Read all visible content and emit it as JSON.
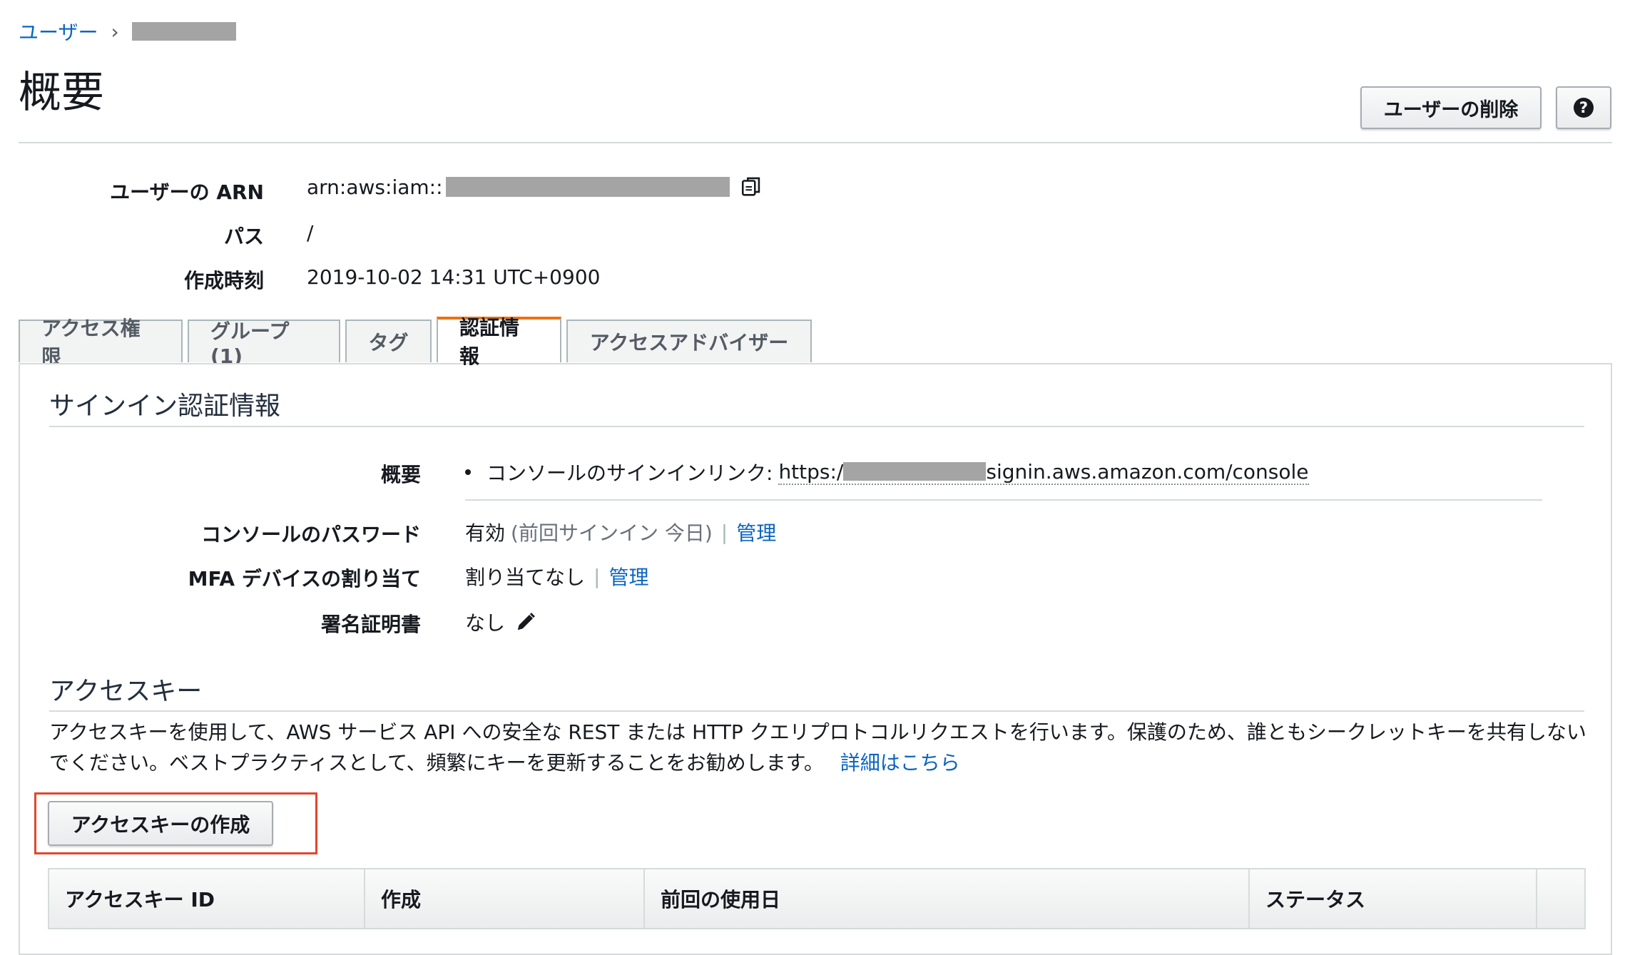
{
  "breadcrumb": {
    "users": "ユーザー",
    "separator": "›"
  },
  "page": {
    "title": "概要"
  },
  "toolbar": {
    "delete_user": "ユーザーの削除",
    "help": "?"
  },
  "summary": {
    "arn_label": "ユーザーの ARN",
    "arn_prefix": "arn:aws:iam::",
    "path_label": "パス",
    "path_value": "/",
    "created_label": "作成時刻",
    "created_value": "2019-10-02 14:31 UTC+0900"
  },
  "tabs": [
    {
      "label": "アクセス権限"
    },
    {
      "label": "グループ (1)"
    },
    {
      "label": "タグ"
    },
    {
      "label": "認証情報"
    },
    {
      "label": "アクセスアドバイザー"
    }
  ],
  "signin": {
    "section_title": "サインイン認証情報",
    "overview_label": "概要",
    "console_link_label": "コンソールのサインインリンク:",
    "console_link_prefix": "https:/",
    "console_link_suffix": "signin.aws.amazon.com/console",
    "password_label": "コンソールのパスワード",
    "password_status": "有効",
    "password_note": "(前回サインイン 今日)",
    "password_manage": "管理",
    "mfa_label": "MFA デバイスの割り当て",
    "mfa_value": "割り当てなし",
    "mfa_manage": "管理",
    "cert_label": "署名証明書",
    "cert_value": "なし"
  },
  "access_keys": {
    "section_title": "アクセスキー",
    "description": "アクセスキーを使用して、AWS サービス API への安全な REST または HTTP クエリプロトコルリクエストを行います。保護のため、誰ともシークレットキーを共有しないでください。ベストプラクティスとして、頻繁にキーを更新することをお勧めします。",
    "learn_more": "詳細はこちら",
    "create_button": "アクセスキーの作成",
    "columns": [
      "アクセスキー ID",
      "作成",
      "前回の使用日",
      "ステータス",
      ""
    ]
  },
  "colors": {
    "link": "#0b65c0",
    "active_tab_accent": "#ec7211",
    "highlight": "#e0472f"
  }
}
